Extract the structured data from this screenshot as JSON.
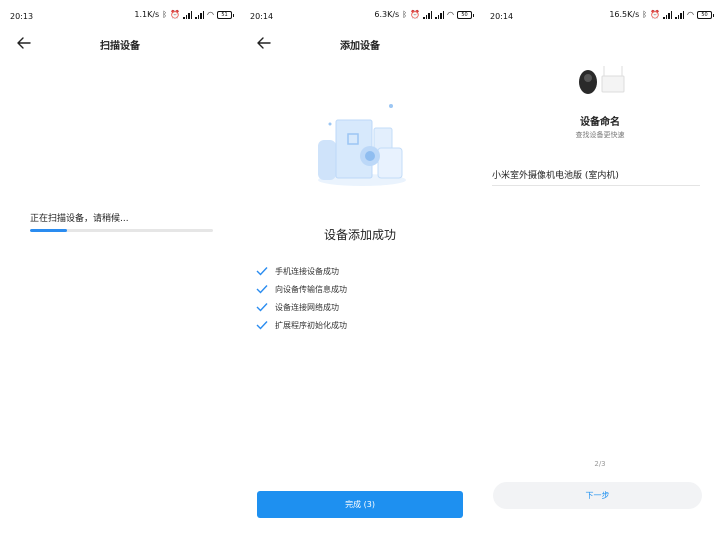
{
  "screens": [
    {
      "status": {
        "time": "20:13",
        "speed": "1.1K/s",
        "battery": "51"
      },
      "title": "扫描设备",
      "scan_text": "正在扫描设备，请稍候...",
      "progress": 0.2
    },
    {
      "status": {
        "time": "20:14",
        "speed": "6.3K/s",
        "battery": "50"
      },
      "title": "添加设备",
      "success_title": "设备添加成功",
      "checks": [
        "手机连接设备成功",
        "向设备传输信息成功",
        "设备连接网络成功",
        "扩展程序初始化成功"
      ],
      "done_label": "完成 (3)"
    },
    {
      "status": {
        "time": "20:14",
        "speed": "16.5K/s",
        "battery": "50"
      },
      "name_title": "设备命名",
      "name_subtitle": "查找设备更快速",
      "device_name": "小米室外摄像机电池版 (室内机)",
      "page_indicator": "2/3",
      "next_label": "下一步"
    }
  ],
  "icons": {
    "status": [
      "bluetooth-icon",
      "alarm-icon",
      "signal-icon",
      "signal-icon",
      "wifi-icon",
      "battery-icon"
    ],
    "nav": "back-arrow-icon",
    "check": "checkmark-icon"
  },
  "colors": {
    "accent": "#1e90f0",
    "progress_bg": "#e6e6e6",
    "button_grey": "#f2f3f5"
  }
}
